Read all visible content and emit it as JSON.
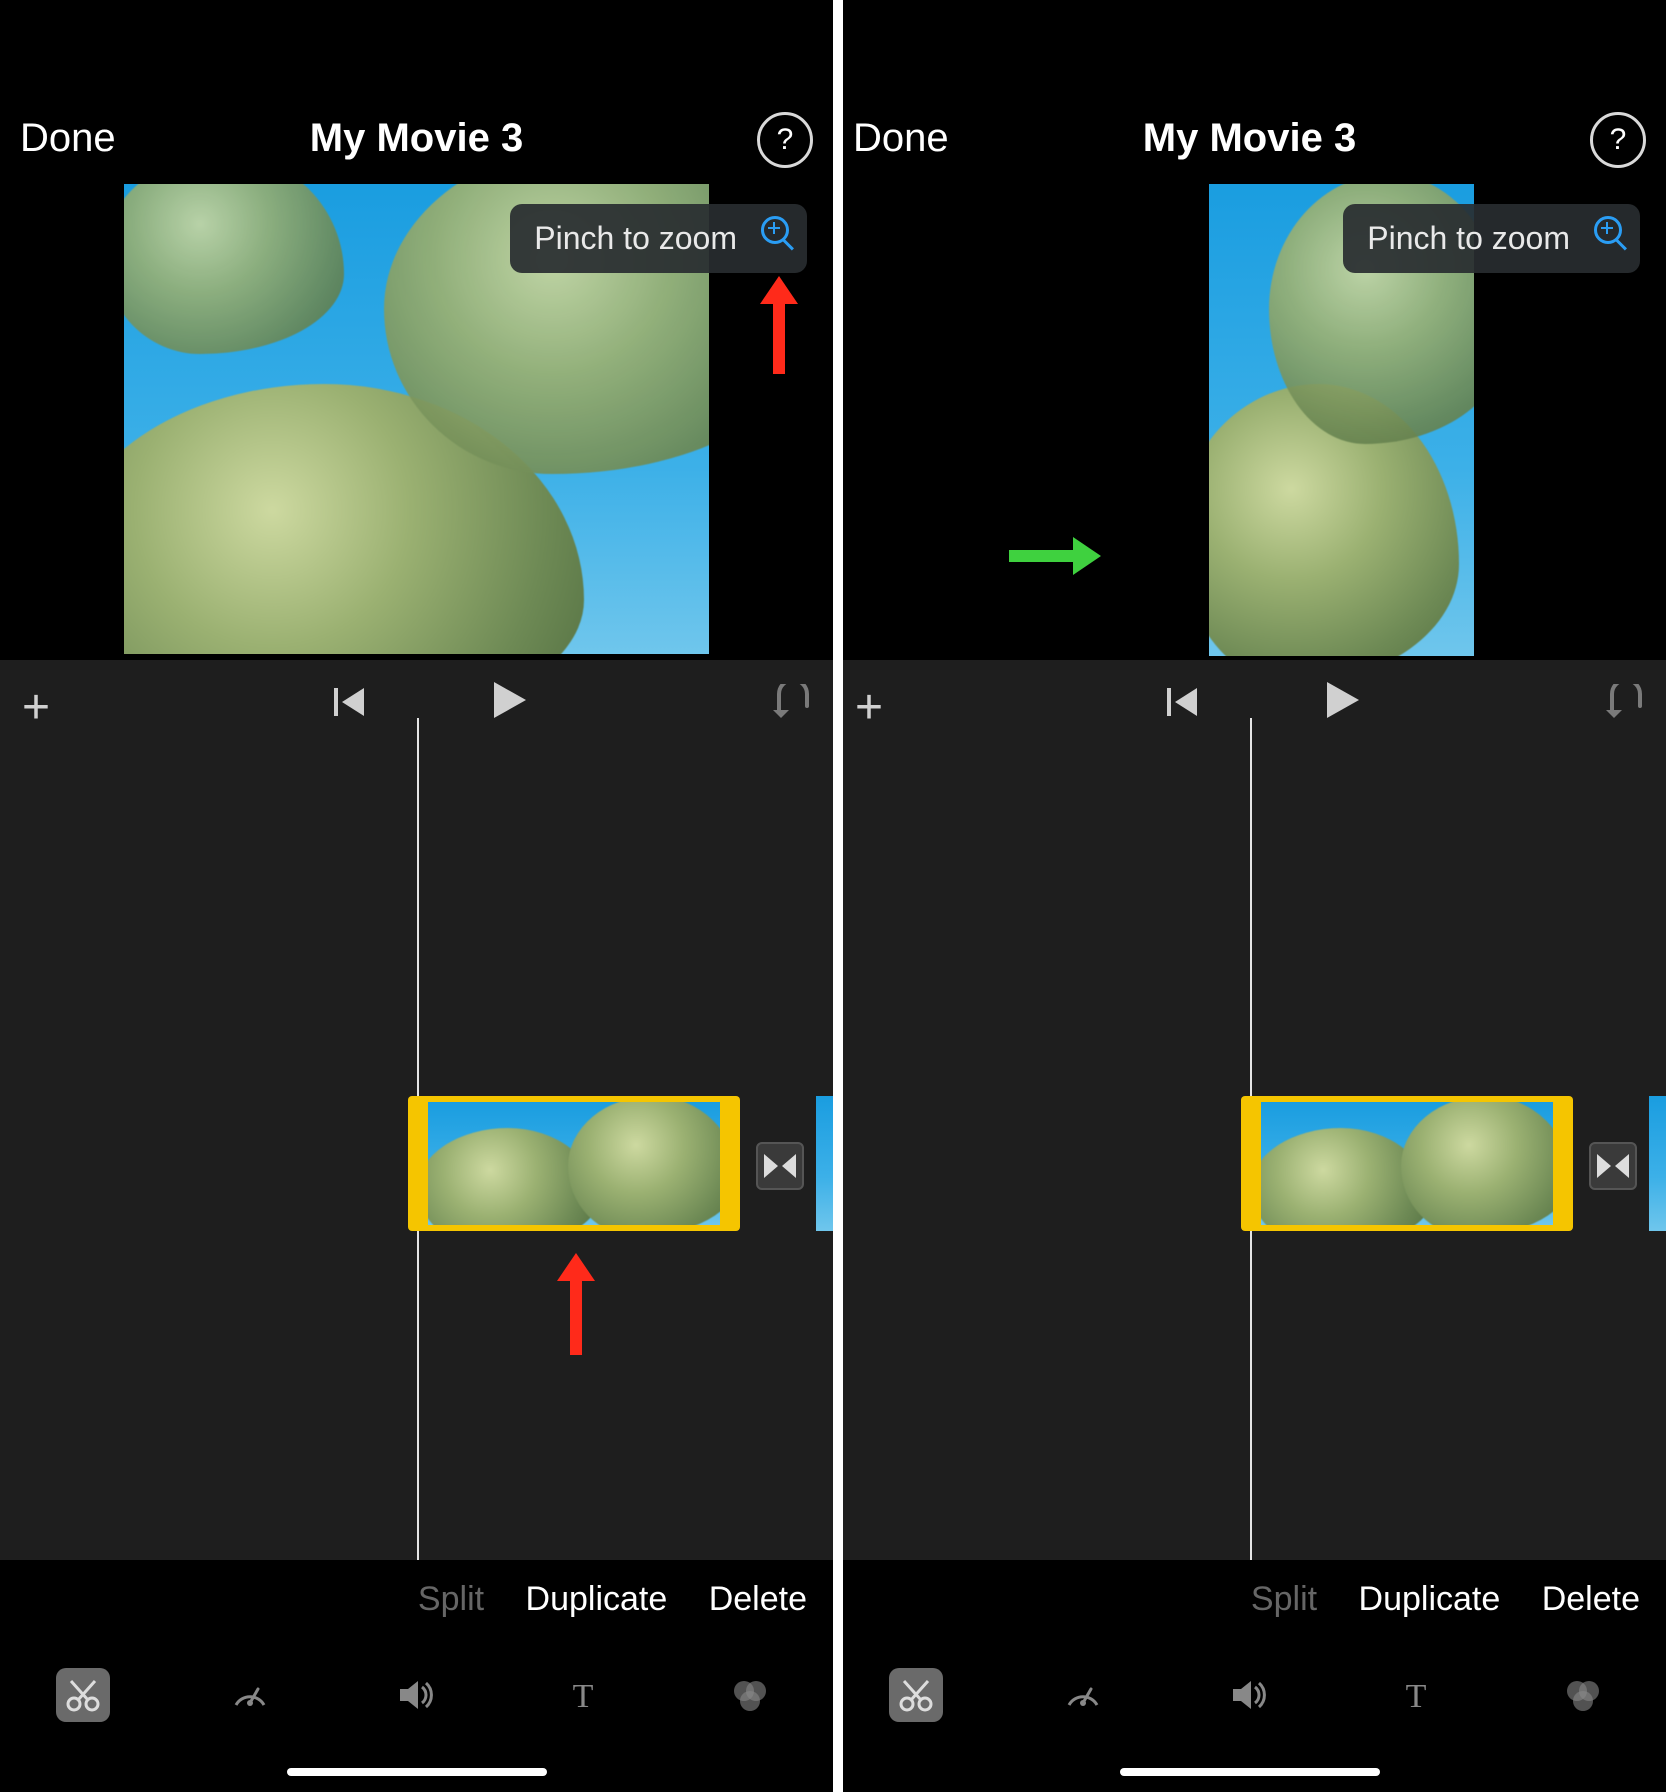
{
  "left": {
    "done": "Done",
    "title": "My Movie 3",
    "help": "?",
    "pinch": "Pinch to zoom",
    "edit": {
      "split": "Split",
      "duplicate": "Duplicate",
      "delete": "Delete"
    }
  },
  "right": {
    "done": "Done",
    "title": "My Movie 3",
    "help": "?",
    "pinch": "Pinch to zoom",
    "edit": {
      "split": "Split",
      "duplicate": "Duplicate",
      "delete": "Delete"
    }
  },
  "tools": [
    "scissors",
    "speed",
    "volume",
    "text",
    "filter"
  ],
  "colors": {
    "accent": "#f5c500",
    "help": "#ffffff",
    "zoom": "#2a9df4"
  }
}
